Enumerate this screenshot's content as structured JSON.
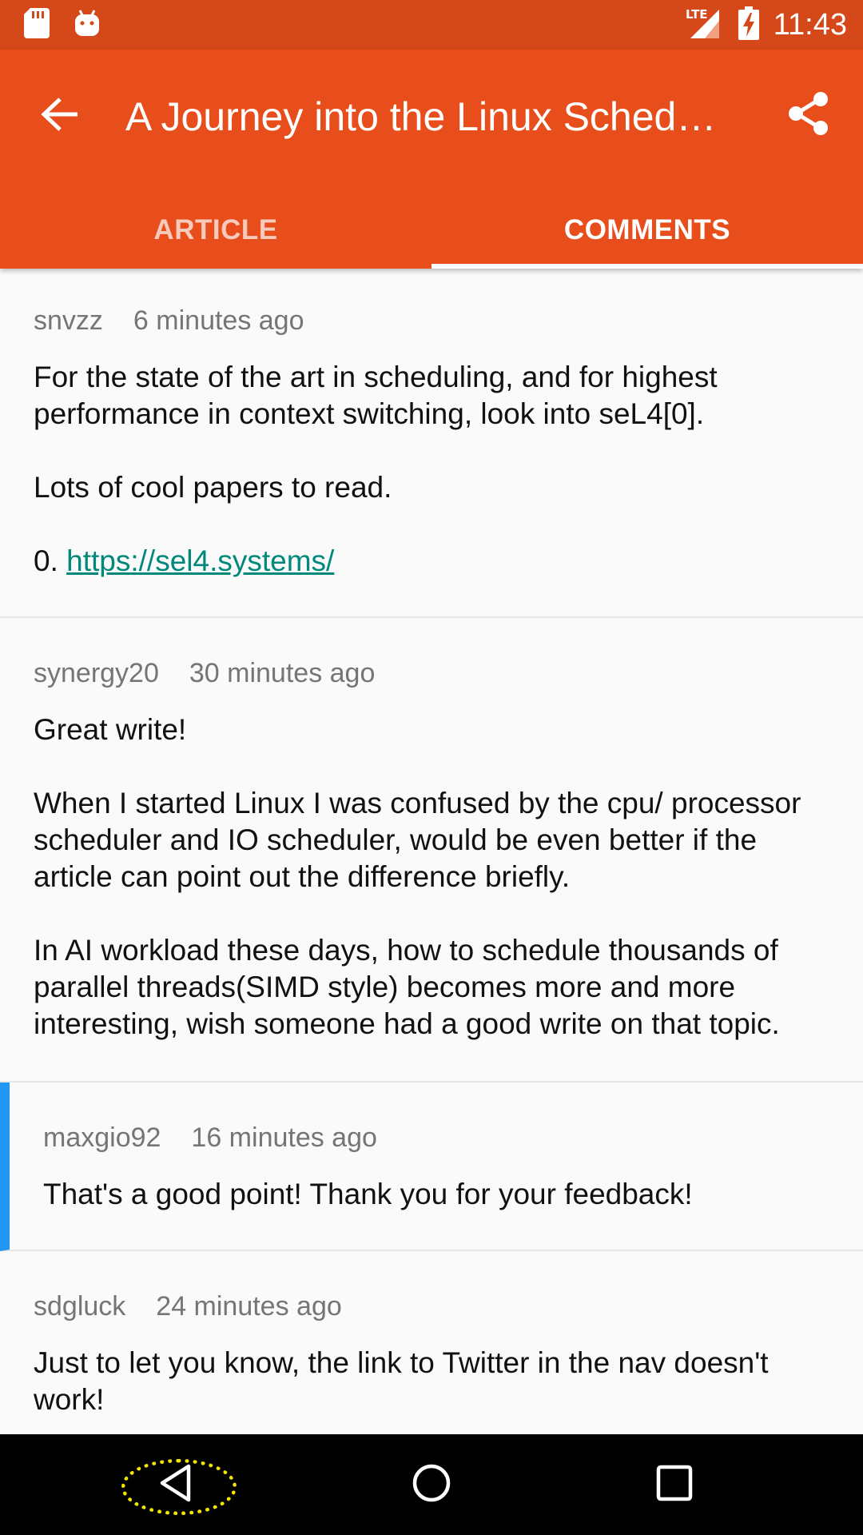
{
  "status_bar": {
    "time": "11:43",
    "network": "LTE"
  },
  "app_bar": {
    "title": "A Journey into the Linux Sched…",
    "tabs": [
      {
        "label": "ARTICLE",
        "active": false
      },
      {
        "label": "COMMENTS",
        "active": true
      }
    ]
  },
  "comments": [
    {
      "author": "snvzz",
      "time": "6 minutes ago",
      "paragraphs": [
        "For the state of the art in scheduling, and for highest performance in context switching, look into seL4[0].",
        "Lots of cool papers to read."
      ],
      "link_prefix": "0. ",
      "link_text": "https://sel4.systems/"
    },
    {
      "author": "synergy20",
      "time": "30 minutes ago",
      "paragraphs": [
        "Great write!",
        "When I started Linux I was confused by the cpu/ processor scheduler and IO scheduler, would be even better if the article can point out the difference briefly.",
        "In AI workload these days, how to schedule thousands of parallel threads(SIMD style) becomes more and more interesting, wish someone had a good write on that topic."
      ]
    },
    {
      "author": "maxgio92",
      "time": "16 minutes ago",
      "is_reply": true,
      "paragraphs": [
        "That's a good point! Thank you for your feedback!"
      ]
    },
    {
      "author": "sdgluck",
      "time": "24 minutes ago",
      "paragraphs": [
        "Just to let you know, the link to Twitter in the nav doesn't work!"
      ]
    }
  ],
  "colors": {
    "status_bar": "#d4481a",
    "app_bar": "#e84e1b",
    "reply_indicator": "#2196f3",
    "link": "#00897b",
    "highlight": "#f2e600"
  },
  "icons": {
    "status_left": [
      "sd-card-icon",
      "android-icon"
    ],
    "status_right": [
      "signal-icon",
      "battery-charging-icon"
    ],
    "app_bar": [
      "back-arrow-icon",
      "share-icon"
    ],
    "nav": [
      "nav-back-icon",
      "nav-home-icon",
      "nav-recents-icon"
    ]
  }
}
